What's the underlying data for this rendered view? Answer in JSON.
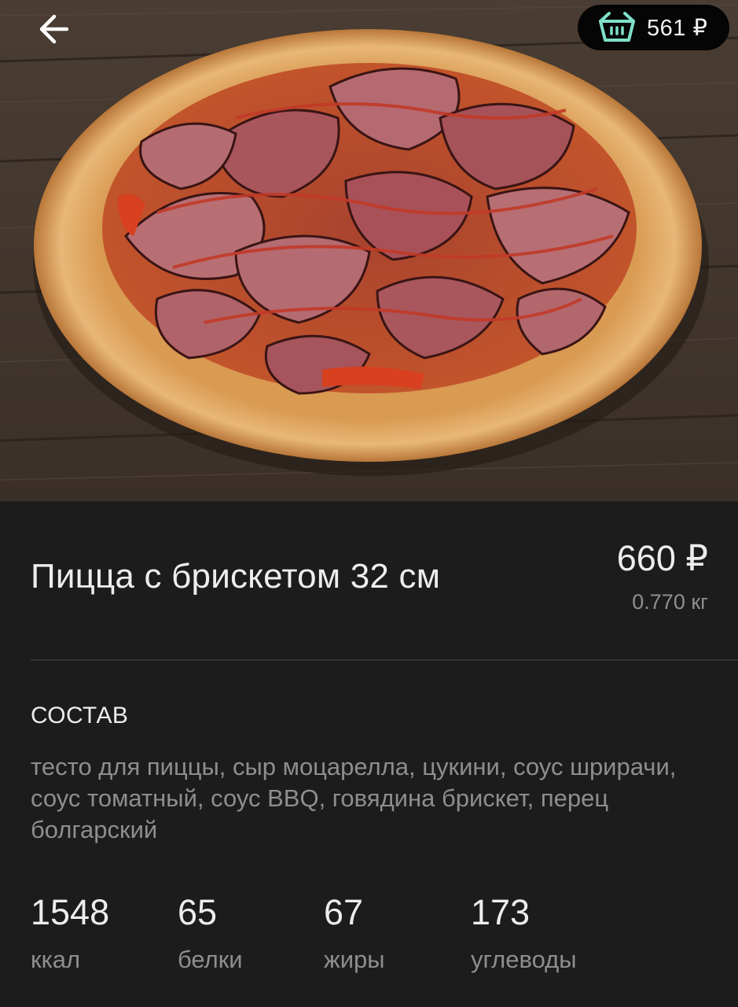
{
  "header": {
    "back_icon": "arrow-left-icon",
    "cart_icon": "basket-icon",
    "cart_total": "561 ₽"
  },
  "product": {
    "title": "Пицца с брискетом 32 см",
    "price": "660 ₽",
    "weight": "0.770 кг",
    "photo_subject": "pizza"
  },
  "composition": {
    "heading": "СОСТАВ",
    "text": "тесто для пиццы, сыр моцарелла, цукини, соус шрирачи, соус томатный, соус BBQ, говядина брискет, перец болгарский"
  },
  "nutrition": [
    {
      "value": "1548",
      "label": "ккал"
    },
    {
      "value": "65",
      "label": "белки"
    },
    {
      "value": "67",
      "label": "жиры"
    },
    {
      "value": "173",
      "label": "углеводы"
    }
  ],
  "colors": {
    "background": "#1c1c1c",
    "primary_text": "#ededed",
    "secondary_text": "#8e8e8e",
    "cart_icon": "#7fe0c8",
    "cart_pill": "#050505"
  }
}
